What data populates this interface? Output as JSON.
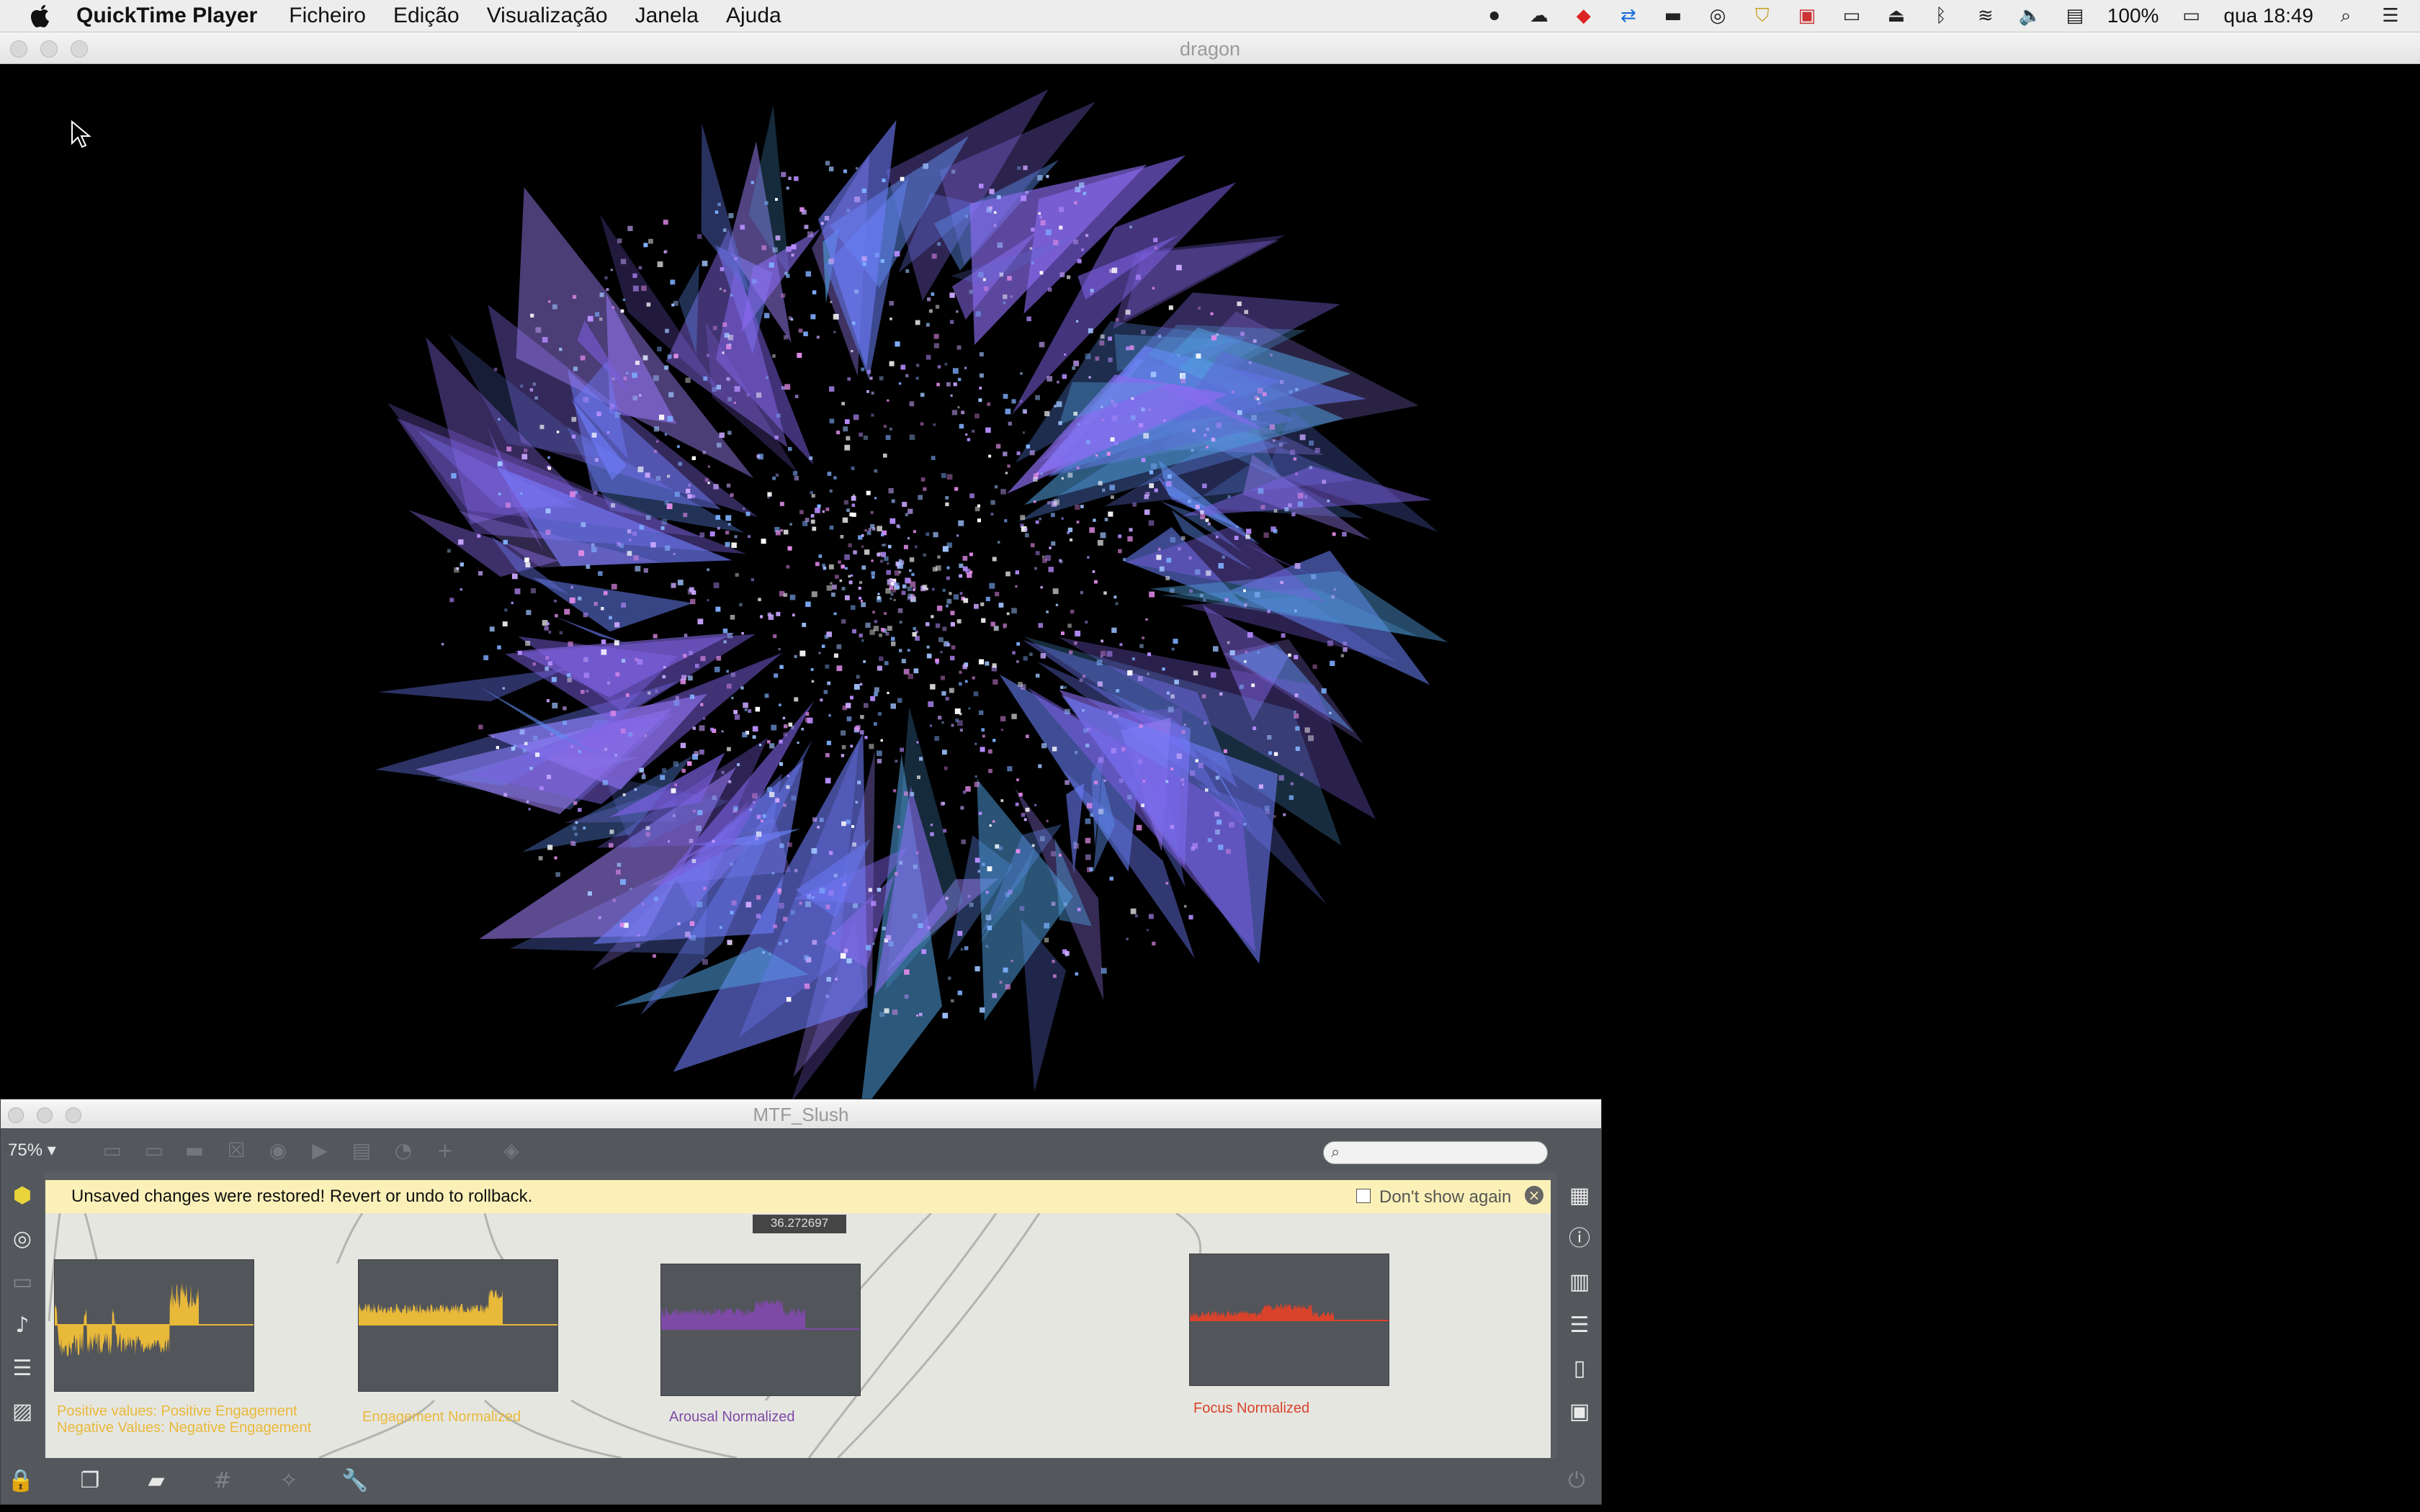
{
  "menubar": {
    "app_name": "QuickTime Player",
    "menus": [
      "Ficheiro",
      "Edição",
      "Visualização",
      "Janela",
      "Ajuda"
    ],
    "battery": "100%",
    "clock": "qua 18:49"
  },
  "player": {
    "title": "dragon"
  },
  "patcher": {
    "title": "MTF_Slush",
    "zoom": "75% ▾",
    "notice": {
      "message": "Unsaved changes were restored! Revert or undo to rollback.",
      "dont_show": "Don't show again"
    },
    "hint_value": "36.272697",
    "scopes": [
      {
        "label_lines": [
          "Positive values: Positive Engagement",
          "Negative Values: Negative Engagement"
        ],
        "color": "#e9b93a"
      },
      {
        "label_lines": [
          "Engagement Normalized"
        ],
        "color": "#e9b93a"
      },
      {
        "label_lines": [
          "Arousal Normalized"
        ],
        "color": "#7d4aa6"
      },
      {
        "label_lines": [
          "Focus Normalized"
        ],
        "color": "#d9432b"
      }
    ]
  }
}
